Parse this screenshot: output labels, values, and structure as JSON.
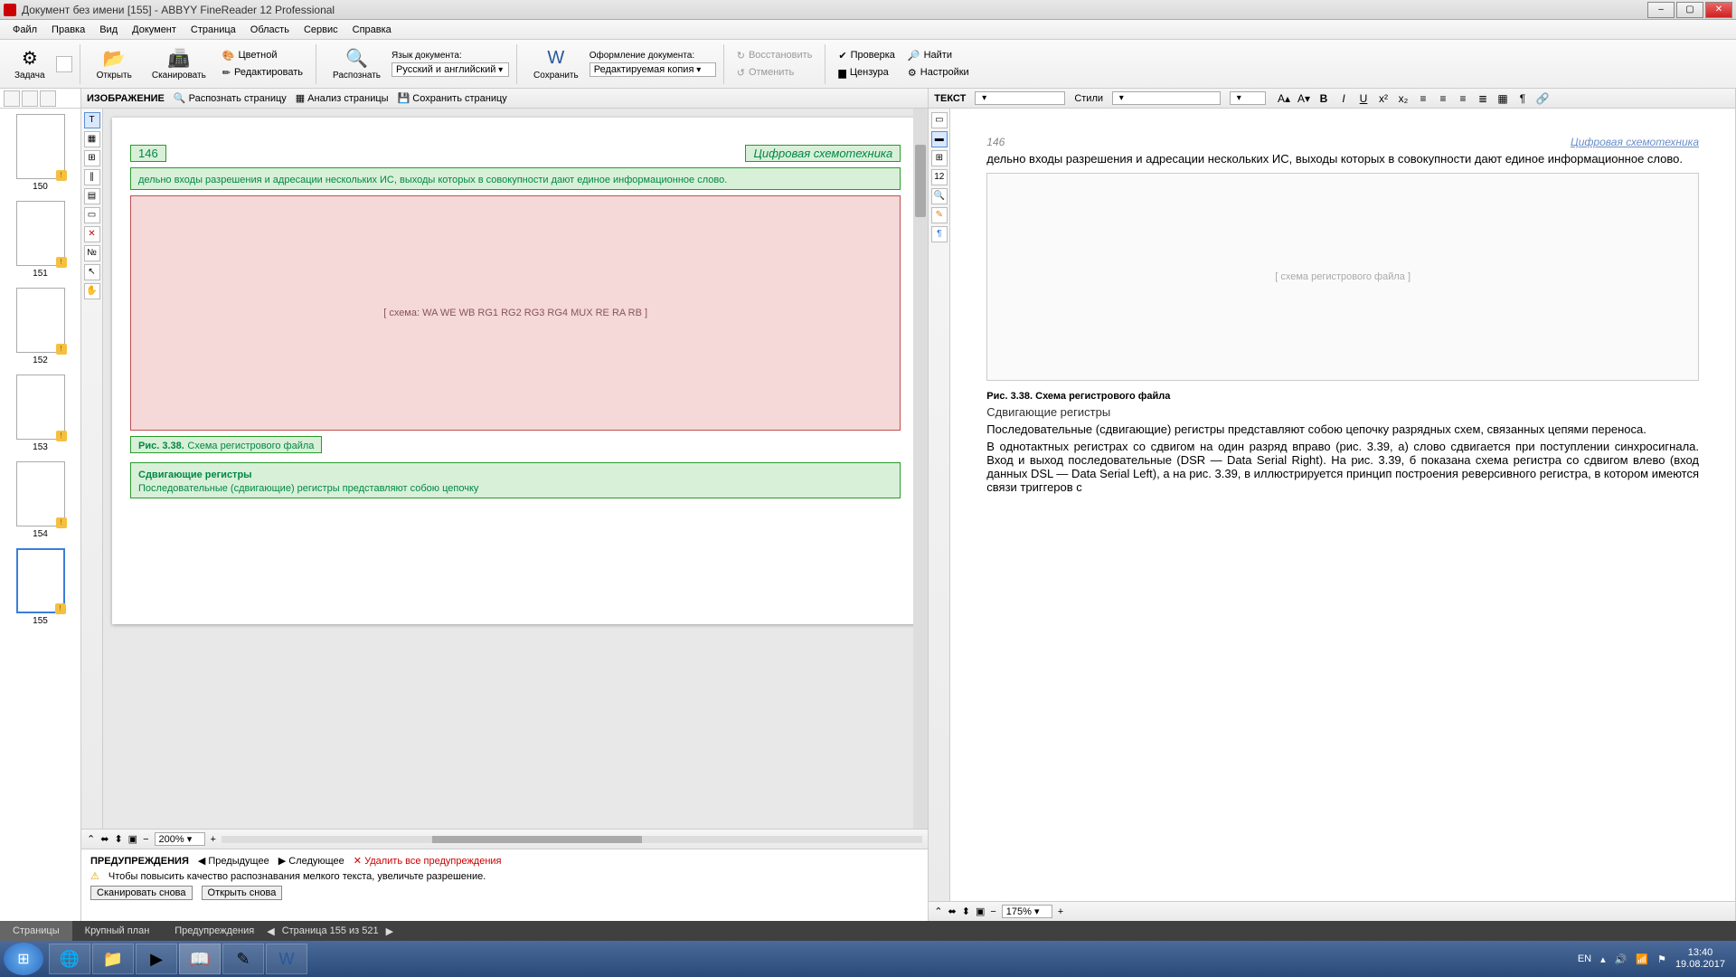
{
  "window": {
    "title": "Документ без имени [155] - ABBYY FineReader 12 Professional"
  },
  "menu": [
    "Файл",
    "Правка",
    "Вид",
    "Документ",
    "Страница",
    "Область",
    "Сервис",
    "Справка"
  ],
  "ribbon": {
    "task": "Задача",
    "open": "Открыть",
    "scan": "Сканировать",
    "color": "Цветной",
    "edit": "Редактировать",
    "recognize": "Распознать",
    "lang_label": "Язык документа:",
    "lang_value": "Русский и английский",
    "save": "Сохранить",
    "format_label": "Оформление документа:",
    "format_value": "Редактируемая копия",
    "restore": "Восстановить",
    "undo": "Отменить",
    "check": "Проверка",
    "find": "Найти",
    "censor": "Цензура",
    "settings": "Настройки"
  },
  "thumbs": [
    150,
    151,
    152,
    153,
    154,
    155
  ],
  "thumb_selected": 155,
  "image_panel": {
    "title": "ИЗОБРАЖЕНИЕ",
    "recognize_page": "Распознать страницу",
    "analyze_page": "Анализ страницы",
    "save_page": "Сохранить страницу",
    "zoom": "200%",
    "page_num": "146",
    "header_right": "Цифровая схемотехника",
    "text1": "дельно входы разрешения и адресации нескольких ИС, выходы которых в совокупности дают единое информационное слово.",
    "fig_caption_bold": "Рис. 3.38.",
    "fig_caption": "Схема регистрового файла",
    "diagram_placeholder": "[ схема: WA WE WB RG1 RG2 RG3 RG4 MUX RE RA RB ]",
    "heading2": "Сдвигающие регистры",
    "text2": "Последовательные (сдвигающие) регистры представляют собою цепочку"
  },
  "text_panel": {
    "title": "ТЕКСТ",
    "style_label": "Стили",
    "zoom": "175%",
    "page_num": "146",
    "header_right": "Цифровая схемотехника",
    "p1": "дельно входы разрешения и адресации нескольких ИС, выходы которых в совокупности дают единое информационное слово.",
    "fig_caption": "Рис. 3.38. Схема регистрового файла",
    "h2": "Сдвигающие регистры",
    "p2": "Последовательные (сдвигающие) регистры представляют собою цепочку разрядных схем, связанных цепями переноса.",
    "p3": "В однотактных регистрах со сдвигом на один разряд вправо (рис. 3.39, а) слово сдвигается при поступлении синхросигнала. Вход и выход последовательные (DSR — Data Serial Right). На рис. 3.39, б показана схема регистра со сдвигом влево (вход данных DSL — Data Serial Left), а на рис. 3.39, в иллюстрируется принцип построения реверсивного регистра, в котором имеются связи триггеров с"
  },
  "warnings": {
    "title": "ПРЕДУПРЕЖДЕНИЯ",
    "prev": "Предыдущее",
    "next": "Следующее",
    "delete_all": "Удалить все предупреждения",
    "msg": "Чтобы повысить качество распознавания мелкого текста, увеличьте разрешение.",
    "scan_again": "Сканировать снова",
    "open_again": "Открыть снова"
  },
  "bottom": {
    "tab_pages": "Страницы",
    "tab_close": "Крупный план",
    "tab_warn": "Предупреждения",
    "page_info": "Страница 155 из 521"
  },
  "tray": {
    "lang": "EN",
    "time": "13:40",
    "date": "19.08.2017"
  }
}
